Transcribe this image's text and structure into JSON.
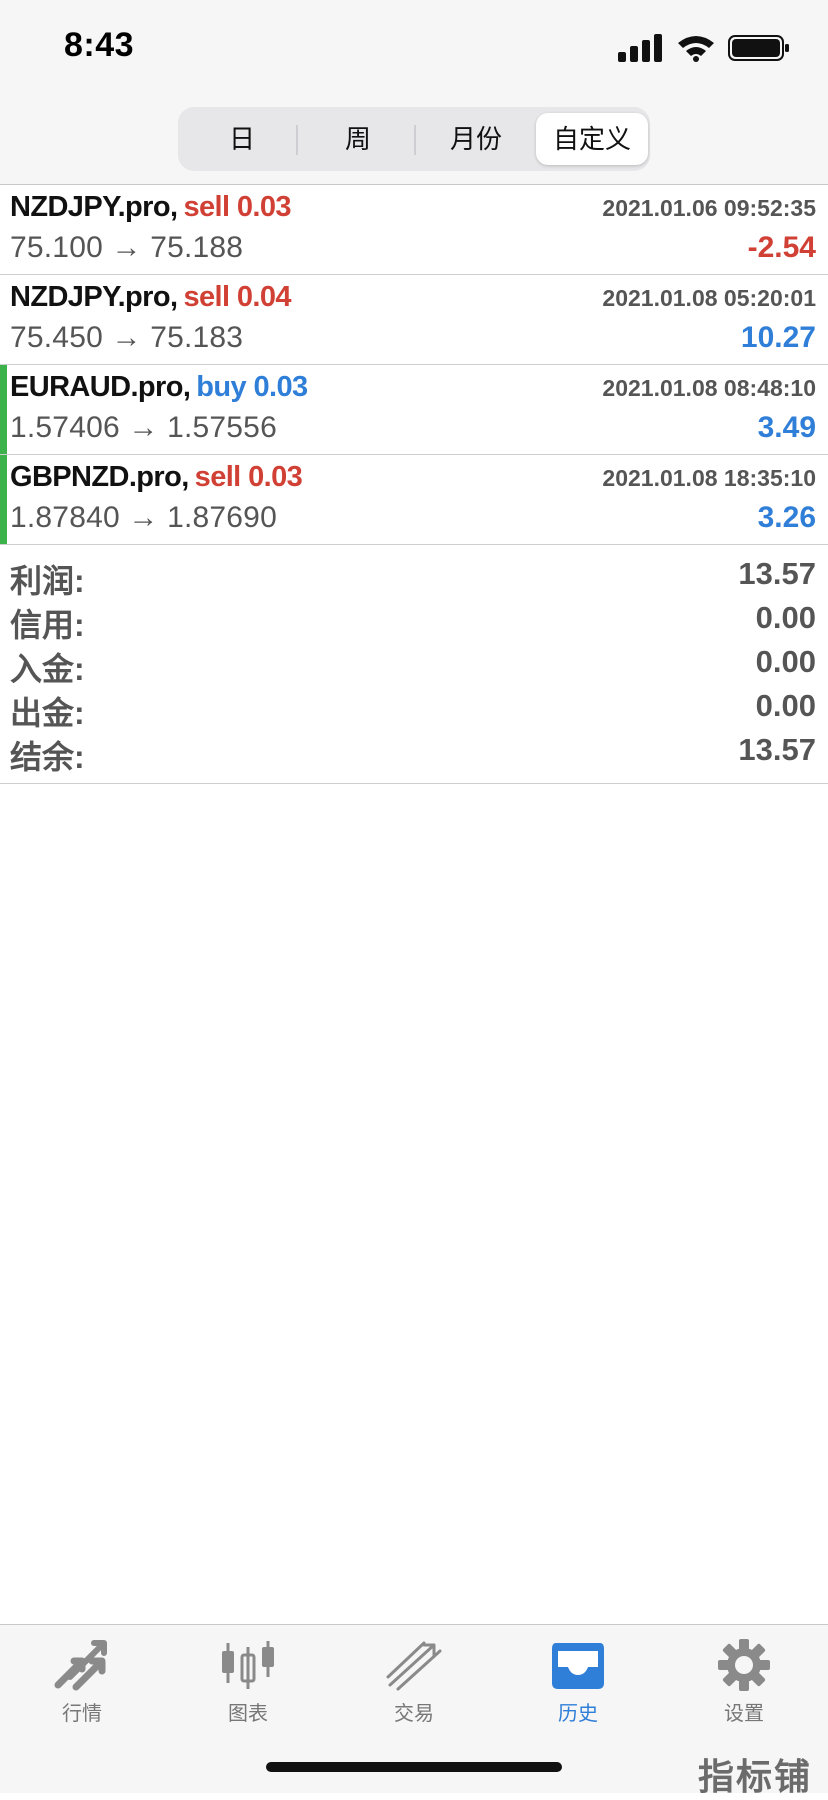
{
  "status_bar": {
    "time": "8:43"
  },
  "segments": [
    {
      "label": "日",
      "active": false
    },
    {
      "label": "周",
      "active": false
    },
    {
      "label": "月份",
      "active": false
    },
    {
      "label": "自定义",
      "active": true
    }
  ],
  "trades": [
    {
      "symbol": "NZDJPY.pro,",
      "action": "sell 0.03",
      "type": "sell",
      "time": "2021.01.06 09:52:35",
      "prices": "75.100 → 75.188",
      "profit": "-2.54",
      "profit_sign": "neg",
      "marker": false
    },
    {
      "symbol": "NZDJPY.pro,",
      "action": "sell 0.04",
      "type": "sell",
      "time": "2021.01.08 05:20:01",
      "prices": "75.450 → 75.183",
      "profit": "10.27",
      "profit_sign": "pos",
      "marker": false
    },
    {
      "symbol": "EURAUD.pro,",
      "action": "buy 0.03",
      "type": "buy",
      "time": "2021.01.08 08:48:10",
      "prices": "1.57406 → 1.57556",
      "profit": "3.49",
      "profit_sign": "pos",
      "marker": true
    },
    {
      "symbol": "GBPNZD.pro,",
      "action": "sell 0.03",
      "type": "sell",
      "time": "2021.01.08 18:35:10",
      "prices": "1.87840 → 1.87690",
      "profit": "3.26",
      "profit_sign": "pos",
      "marker": true
    }
  ],
  "summary": [
    {
      "label": "利润:",
      "value": "13.57"
    },
    {
      "label": "信用:",
      "value": "0.00"
    },
    {
      "label": "入金:",
      "value": "0.00"
    },
    {
      "label": "出金:",
      "value": "0.00"
    },
    {
      "label": "结余:",
      "value": "13.57"
    }
  ],
  "tabs": [
    {
      "label": "行情",
      "icon": "quotes-icon",
      "active": false
    },
    {
      "label": "图表",
      "icon": "chart-icon",
      "active": false
    },
    {
      "label": "交易",
      "icon": "trade-icon",
      "active": false
    },
    {
      "label": "历史",
      "icon": "history-icon",
      "active": true
    },
    {
      "label": "设置",
      "icon": "settings-icon",
      "active": false
    }
  ],
  "watermark": "指标铺",
  "colors": {
    "sell": "#d14034",
    "buy": "#2f7ed8",
    "active_tab": "#2f7ed8",
    "marker": "#3bb34a"
  }
}
